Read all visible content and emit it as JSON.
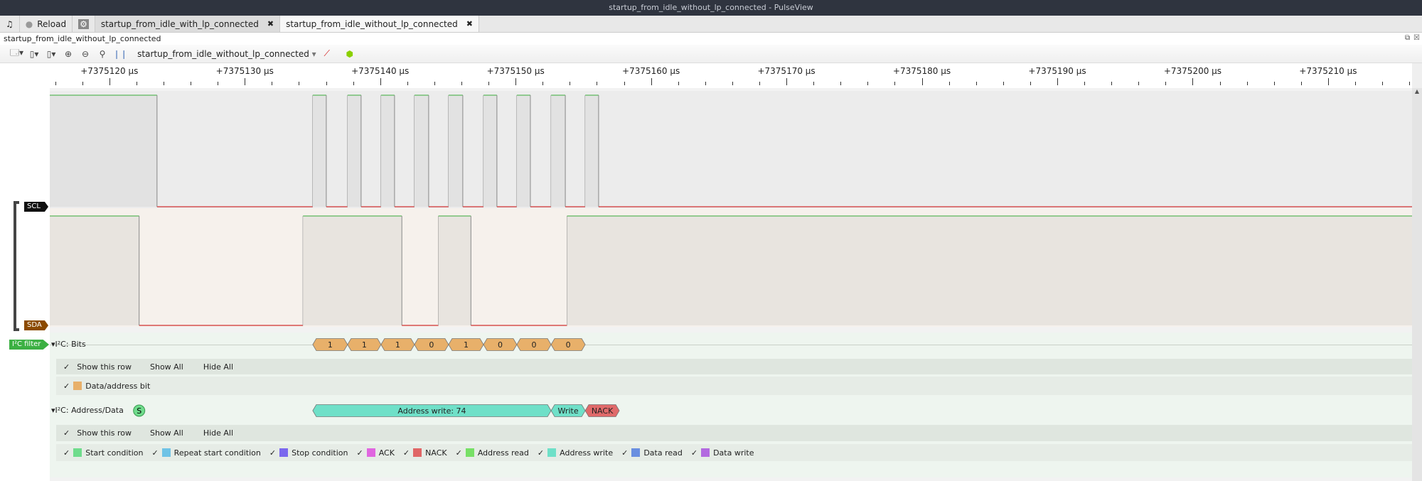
{
  "window": {
    "title": "startup_from_idle_without_lp_connected - PulseView"
  },
  "tabs": {
    "reload": "Reload",
    "items": [
      {
        "label": "startup_from_idle_with_lp_connected",
        "active": false
      },
      {
        "label": "startup_from_idle_without_lp_connected",
        "active": true
      }
    ]
  },
  "session": {
    "filename": "startup_from_idle_without_lp_connected"
  },
  "toolbar": {
    "device": "startup_from_idle_without_lp_connected"
  },
  "ruler": {
    "unit": "µs",
    "labels": [
      "+7375120 µs",
      "+7375130 µs",
      "+7375140 µs",
      "+7375150 µs",
      "+7375160 µs",
      "+7375170 µs",
      "+7375180 µs",
      "+7375190 µs",
      "+7375200 µs",
      "+7375210 µs"
    ],
    "first_us": 120,
    "step_us": 10,
    "minor_per_major": 5
  },
  "view": {
    "start_us": 115.6,
    "end_us": 216.2
  },
  "signals": [
    {
      "name": "SCL",
      "color": "#111111",
      "initial": 1,
      "edges_us": [
        123.52,
        135.02,
        136.02,
        137.59,
        138.59,
        140.06,
        141.06,
        142.53,
        143.58,
        145.05,
        146.1,
        147.63,
        148.62,
        150.09,
        151.09,
        152.62,
        153.67,
        155.14,
        156.13
      ]
    },
    {
      "name": "SDA",
      "color": "#8b4a00",
      "initial": 1,
      "edges_us": [
        122.2,
        134.3,
        141.6,
        144.3,
        146.7,
        153.8
      ]
    }
  ],
  "decoder": {
    "filter_label": "I²C filter",
    "rows": [
      {
        "title": "I²C: Bits",
        "show_row": "Show this row",
        "show_all": "Show All",
        "hide_all": "Hide All",
        "legend": [
          {
            "label": "Data/address bit",
            "color": "#e8b06a"
          }
        ],
        "annotations": [
          {
            "text": "1",
            "start_us": 135.02,
            "end_us": 137.59,
            "color": "#e8b06a"
          },
          {
            "text": "1",
            "start_us": 137.59,
            "end_us": 140.06,
            "color": "#e8b06a"
          },
          {
            "text": "1",
            "start_us": 140.06,
            "end_us": 142.53,
            "color": "#e8b06a"
          },
          {
            "text": "0",
            "start_us": 142.53,
            "end_us": 145.05,
            "color": "#e8b06a"
          },
          {
            "text": "1",
            "start_us": 145.05,
            "end_us": 147.63,
            "color": "#e8b06a"
          },
          {
            "text": "0",
            "start_us": 147.63,
            "end_us": 150.09,
            "color": "#e8b06a"
          },
          {
            "text": "0",
            "start_us": 150.09,
            "end_us": 152.62,
            "color": "#e8b06a"
          },
          {
            "text": "0",
            "start_us": 152.62,
            "end_us": 155.14,
            "color": "#e8b06a"
          }
        ]
      },
      {
        "title": "I²C: Address/Data",
        "show_row": "Show this row",
        "show_all": "Show All",
        "hide_all": "Hide All",
        "start_marker": {
          "text": "S",
          "at_us": 122.2,
          "color": "#6fdc8c"
        },
        "legend": [
          {
            "label": "Start condition",
            "color": "#6fdc8c"
          },
          {
            "label": "Repeat start condition",
            "color": "#6fc3e6"
          },
          {
            "label": "Stop condition",
            "color": "#7b68ee"
          },
          {
            "label": "ACK",
            "color": "#e066e0"
          },
          {
            "label": "NACK",
            "color": "#e06666"
          },
          {
            "label": "Address read",
            "color": "#77e066"
          },
          {
            "label": "Address write",
            "color": "#6fe0c8"
          },
          {
            "label": "Data read",
            "color": "#6a8fe0"
          },
          {
            "label": "Data write",
            "color": "#b36ae0"
          }
        ],
        "annotations": [
          {
            "text": "Address write: 74",
            "start_us": 135.02,
            "end_us": 152.62,
            "color": "#6fe0c8"
          },
          {
            "text": "Write",
            "start_us": 152.62,
            "end_us": 155.14,
            "color": "#6fe0c8"
          },
          {
            "text": "NACK",
            "start_us": 155.14,
            "end_us": 157.66,
            "color": "#e06a6a"
          }
        ]
      }
    ]
  }
}
